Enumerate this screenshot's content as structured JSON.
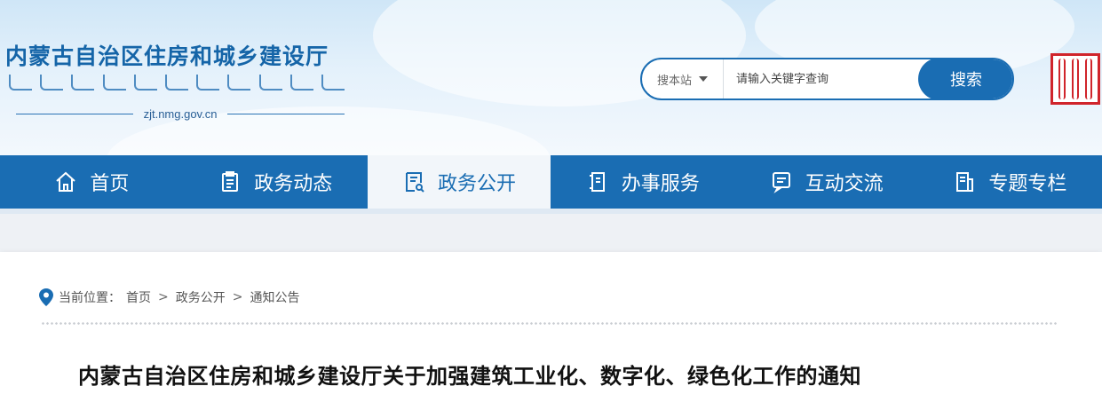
{
  "header": {
    "site_title": "内蒙古自治区住房和城乡建设厅",
    "domain": "zjt.nmg.gov.cn"
  },
  "search": {
    "scope_label": "搜本站",
    "placeholder": "请输入关键字查询",
    "button_label": "搜索"
  },
  "nav": {
    "items": [
      {
        "label": "首页",
        "icon": "home-icon"
      },
      {
        "label": "政务动态",
        "icon": "clipboard-icon"
      },
      {
        "label": "政务公开",
        "icon": "document-icon"
      },
      {
        "label": "办事服务",
        "icon": "service-icon"
      },
      {
        "label": "互动交流",
        "icon": "chat-icon"
      },
      {
        "label": "专题专栏",
        "icon": "column-icon"
      }
    ],
    "active_index": 2
  },
  "breadcrumb": {
    "prefix": "当前位置：",
    "items": [
      "首页",
      "政务公开",
      "通知公告"
    ],
    "separator": ">"
  },
  "article": {
    "title": "内蒙古自治区住房和城乡建设厅关于加强建筑工业化、数字化、绿色化工作的通知"
  },
  "colors": {
    "brand_blue": "#1a6db3",
    "seal_red": "#d0242b"
  }
}
